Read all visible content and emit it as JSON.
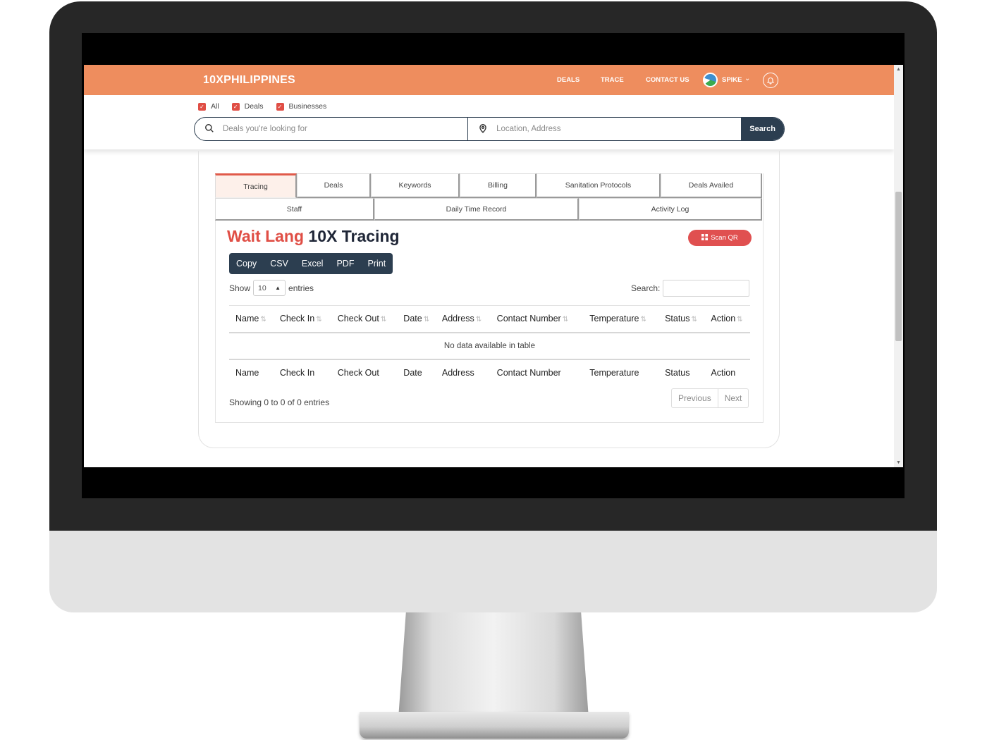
{
  "navbar": {
    "brand": "10XPHILIPPINES",
    "links": [
      "DEALS",
      "TRACE",
      "CONTACT US"
    ],
    "user": "SPIKE",
    "accent_color": "#ee8d5e"
  },
  "filters": [
    {
      "label": "All",
      "checked": true
    },
    {
      "label": "Deals",
      "checked": true
    },
    {
      "label": "Businesses",
      "checked": true
    }
  ],
  "search": {
    "deals_placeholder": "Deals you're looking for",
    "location_placeholder": "Location, Address",
    "button": "Search"
  },
  "tabs_row1": [
    {
      "label": "Tracing",
      "active": true
    },
    {
      "label": "Deals"
    },
    {
      "label": "Keywords"
    },
    {
      "label": "Billing"
    },
    {
      "label": "Sanitation Protocols"
    },
    {
      "label": "Deals Availed"
    }
  ],
  "tabs_row2": [
    {
      "label": "Staff"
    },
    {
      "label": "Daily Time Record"
    },
    {
      "label": "Activity Log"
    }
  ],
  "page": {
    "title_part1": "Wait Lang",
    "title_part2": "10X Tracing",
    "scan_button": "Scan QR"
  },
  "export_buttons": [
    "Copy",
    "CSV",
    "Excel",
    "PDF",
    "Print"
  ],
  "table": {
    "show_label": "Show",
    "length_value": "10",
    "entries_label": "entries",
    "search_label": "Search:",
    "columns": [
      "Name",
      "Check In",
      "Check Out",
      "Date",
      "Address",
      "Contact Number",
      "Temperature",
      "Status",
      "Action"
    ],
    "empty_message": "No data available in table",
    "info": "Showing 0 to 0 of 0 entries",
    "prev": "Previous",
    "next": "Next"
  },
  "icons": {
    "search": "search-icon",
    "location": "map-pin-icon",
    "bell": "bell-icon",
    "qr": "qr-icon",
    "sort": "sort-icon",
    "chevron": "chevron-down-icon"
  },
  "colors": {
    "navbar": "#ee8d5e",
    "dark": "#2c3e50",
    "red": "#e04e45",
    "title_dark": "#1f2637"
  }
}
